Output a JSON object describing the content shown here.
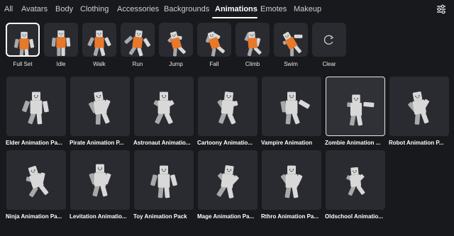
{
  "tabs": [
    {
      "label": "All"
    },
    {
      "label": "Avatars"
    },
    {
      "label": "Body"
    },
    {
      "label": "Clothing"
    },
    {
      "label": "Accessories"
    },
    {
      "label": "Backgrounds"
    },
    {
      "label": "Animations",
      "active": true
    },
    {
      "label": "Emotes"
    },
    {
      "label": "Makeup"
    }
  ],
  "filter_icon": "sliders-icon",
  "slots": [
    {
      "label": "Full Set",
      "selected": true
    },
    {
      "label": "Idle"
    },
    {
      "label": "Walk"
    },
    {
      "label": "Run"
    },
    {
      "label": "Jump"
    },
    {
      "label": "Fall"
    },
    {
      "label": "Climb"
    },
    {
      "label": "Swim"
    },
    {
      "label": "Clear",
      "icon": "refresh-icon"
    }
  ],
  "catalog": [
    {
      "label": "Elder Animation Pa..."
    },
    {
      "label": "Pirate Animation P..."
    },
    {
      "label": "Astronaut Animatio..."
    },
    {
      "label": "Cartoony Animatio..."
    },
    {
      "label": "Vampire Animation"
    },
    {
      "label": "Zombie Animation ...",
      "selected": true
    },
    {
      "label": "Robot Animation P..."
    },
    {
      "label": "Ninja Animation Pa..."
    },
    {
      "label": "Levitation Animatio..."
    },
    {
      "label": "Toy Animation Pack"
    },
    {
      "label": "Mage Animation Pa..."
    },
    {
      "label": "Rthro Animation Pa..."
    },
    {
      "label": "Oldschool Animatio..."
    }
  ],
  "colors": {
    "background": "#18191c",
    "tile": "#2a2b30",
    "accent_text": "#ffffff",
    "avatar_shirt": "#e8782a",
    "avatar_body": "#d8d8d8"
  }
}
